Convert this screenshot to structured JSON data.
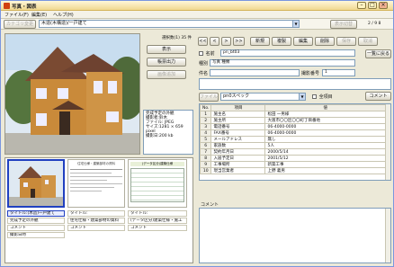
{
  "window": {
    "title": "写真・図表",
    "page_count": "2 / 9 8"
  },
  "menu": [
    "ファイル(F)",
    "編集(E)",
    "ヘルプ(H)"
  ],
  "toolbar": {
    "category_button": "カテゴリ変更",
    "category_value": "木造(木構造)/一戸建て",
    "right_button": "表示切替"
  },
  "left": {
    "photo_count": "選択数(1) 35 件",
    "buttons": [
      "表示",
      "帳票出力",
      "画像追加"
    ],
    "info_lines": [
      "完成予定の外観",
      "撮影者:鈴木",
      "ファイル: JPEG",
      "サイズ:1281 × 659 pixel",
      "撮影日:200 kb"
    ]
  },
  "thumbnails": [
    {
      "title": "タイトル:(木造)一戸建て",
      "memo": "完成予定の外観",
      "comment": "コメント",
      "extra": "撮影日時"
    },
    {
      "title": "タイトル:",
      "memo": "住宅仕様・建築部材の資料",
      "comment": "コメント"
    },
    {
      "title": "タイトル:",
      "memo": "(データ区分)建築仕様・施工",
      "comment": "コメント"
    }
  ],
  "doc_thumb": {
    "heading": "住宅仕様・建築部材の資料"
  },
  "table_thumb": {
    "heading": "(データ区分)建築仕様"
  },
  "nav": {
    "prev_first": "<<",
    "prev": "<",
    "next": ">",
    "next_last": ">>"
  },
  "right_toolbar": [
    "新規",
    "複製",
    "編集",
    "削除",
    "保存",
    "取消"
  ],
  "list_button": "一覧に戻る",
  "form": {
    "name_label": "名前",
    "name_value": "pn_bt03",
    "type_label": "種別",
    "type_value": "写真 種類",
    "date_label": "撮影",
    "date_value": "",
    "number_label": "撮影番号",
    "number_value": "1",
    "subject_label": "件名",
    "spec_label": "ファイル",
    "spec_value": "pn0スペック",
    "all_check": "全項目",
    "comment_btn": "コメント"
  },
  "grid": {
    "headers": [
      "No.",
      "項目",
      "値"
    ],
    "rows": [
      [
        "1",
        "施主名",
        "松田 一男様"
      ],
      [
        "2",
        "施主所",
        "大阪市〇〇区〇〇町丁目番地"
      ],
      [
        "3",
        "電話番号",
        "06-4000-0000"
      ],
      [
        "4",
        "FAX番号",
        "06-4000-0000"
      ],
      [
        "5",
        "メールアドレス",
        "無し"
      ],
      [
        "6",
        "家族数",
        "5人"
      ],
      [
        "7",
        "契約年月日",
        "2000/5/14"
      ],
      [
        "8",
        "入居予定日",
        "2001/5/12"
      ],
      [
        "9",
        "工事場所",
        "新築工事"
      ],
      [
        "10",
        "現当営業者",
        "上野 義男"
      ]
    ]
  },
  "memo_label": "コメント"
}
